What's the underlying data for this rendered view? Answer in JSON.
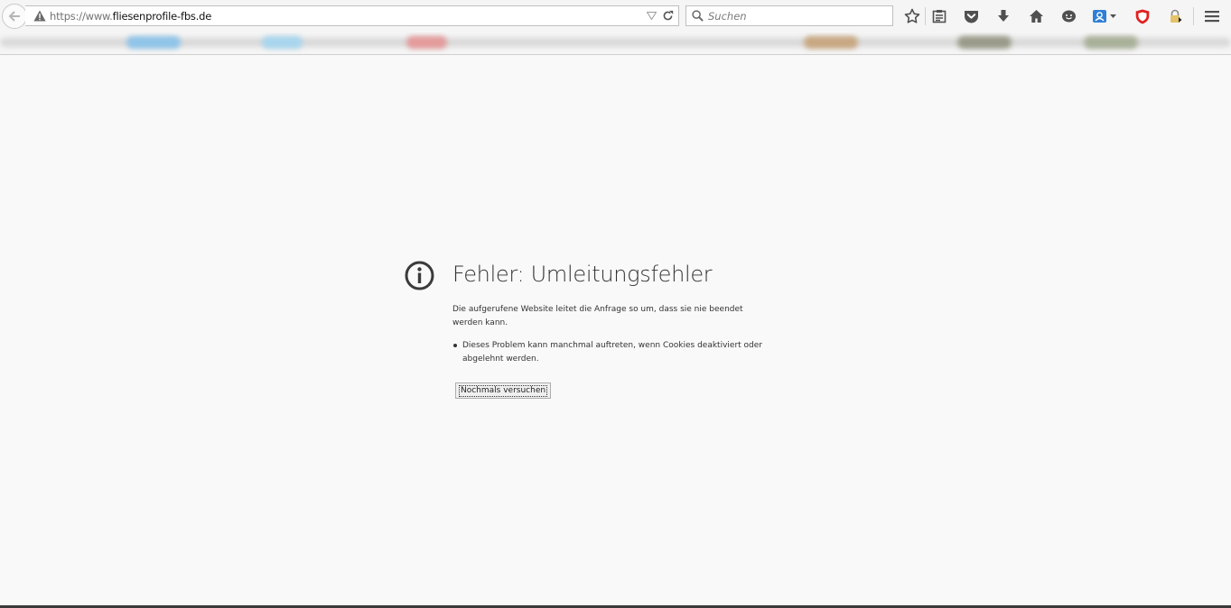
{
  "browser": {
    "url_prefix": "https://www.",
    "url_domain": "fliesenprofile-fbs.de",
    "search_placeholder": "Suchen",
    "icons": [
      "back-icon",
      "warning-icon",
      "dropdown-icon",
      "reload-icon",
      "search-icon",
      "star-icon",
      "reader-icon",
      "pocket-icon",
      "download-icon",
      "home-icon",
      "smiley-icon",
      "account-icon",
      "ublock-icon",
      "lock-icon",
      "menu-icon"
    ]
  },
  "error": {
    "title": "Fehler: Umleitungsfehler",
    "description": "Die aufgerufene Website leitet die Anfrage so um, dass sie nie beendet werden kann.",
    "bullet": "Dieses Problem kann manchmal auftreten, wenn Cookies deaktiviert oder abgelehnt werden.",
    "retry_label": "Nochmals versuchen"
  },
  "colors": {
    "page_bg": "#f9f9fa",
    "text": "#333333",
    "ublock_red": "#e0211f",
    "account_blue": "#2f7fd6"
  }
}
